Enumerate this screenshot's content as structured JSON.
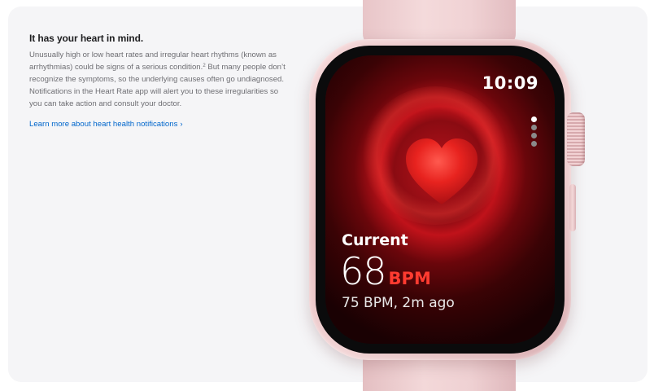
{
  "section": {
    "headline": "It has your heart in mind.",
    "body_part1": "Unusually high or low heart rates and irregular heart rhythms (known as arrhythmias) could be signs of a serious condition.",
    "footnote": "2",
    "body_part2": " But many people don’t recognize the symptoms, so the underlying causes often go undiagnosed. Notifications in the Heart Rate app will alert you to these irregularities so you can take action and consult your doctor.",
    "link_label": "Learn more about heart health notifications",
    "link_chevron": "›"
  },
  "watch": {
    "time": "10:09",
    "current_label": "Current",
    "bpm_value": "68",
    "bpm_unit": "BPM",
    "history": "75 BPM, 2m ago",
    "page_dots": 4,
    "active_page": 1,
    "heart_icon": "heart-icon",
    "colors": {
      "accent_red": "#ff3b30",
      "link_blue": "#0066cc",
      "case_pink": "#efcdd0"
    }
  }
}
